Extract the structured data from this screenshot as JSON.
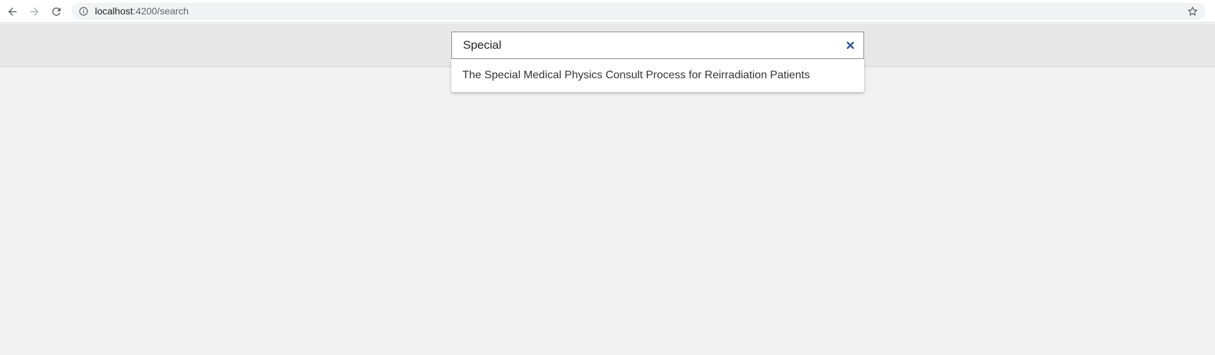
{
  "browser": {
    "url_host": "localhost",
    "url_path": ":4200/search",
    "icons": {
      "back": "arrow-left-icon",
      "forward": "arrow-right-icon",
      "reload": "reload-icon",
      "info": "info-icon",
      "bookmark": "star-icon"
    }
  },
  "search": {
    "value": "Special",
    "clear_icon": "close-icon",
    "accent_color": "#2f4f8f",
    "suggestions": [
      {
        "label": "The Special Medical Physics Consult Process for Reirradiation Patients"
      }
    ]
  }
}
